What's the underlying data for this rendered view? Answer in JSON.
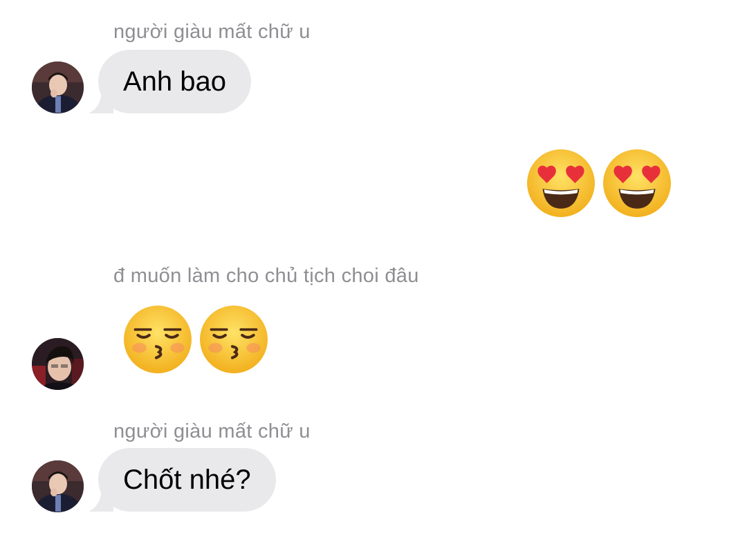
{
  "messages": [
    {
      "sender": "người giàu mất chữ u",
      "text": "Anh bao"
    },
    {
      "outgoing_emoji": [
        "smiling-face-heart-eyes",
        "smiling-face-heart-eyes"
      ]
    },
    {
      "sender": "đ muốn làm cho chủ tịch choi đâu",
      "emoji": [
        "kissing-face-closed-eyes",
        "kissing-face-closed-eyes"
      ]
    },
    {
      "sender": "người giàu mất chữ u",
      "text": "Chốt nhé?"
    }
  ],
  "colors": {
    "bubble_incoming": "#e9e9eb",
    "sender_text": "#8e8e93",
    "emoji_yellow": "#fcc21b",
    "heart_red": "#e8303a"
  }
}
